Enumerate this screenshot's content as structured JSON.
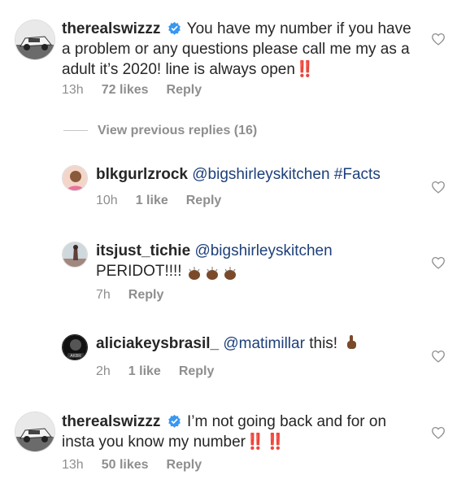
{
  "thread": {
    "view_previous": "View previous replies (16)",
    "comments": [
      {
        "username": "therealswizzz",
        "verified": true,
        "text": "You have my number if you have a problem or any questions please call me my as a adult it’s 2020! line is always open",
        "emoji_suffix": "‼️",
        "time": "13h",
        "likes": "72 likes",
        "reply": "Reply"
      },
      {
        "username": "blkgurlzrock",
        "mention": "@bigshirleyskitchen",
        "hashtag": "#Facts",
        "time": "10h",
        "likes": "1 like",
        "reply": "Reply"
      },
      {
        "username": "itsjust_tichie",
        "mention": "@bigshirleyskitchen",
        "text": "PERIDOT!!!!",
        "emoji": "👏🏾👏🏾👏🏾",
        "time": "7h",
        "reply": "Reply"
      },
      {
        "username": "aliciakeysbrasil_",
        "mention": "@matimillar",
        "text": "this!",
        "emoji": "👆🏾",
        "time": "2h",
        "likes": "1 like",
        "reply": "Reply"
      },
      {
        "username": "therealswizzz",
        "verified": true,
        "text": "I’m not going back and for on insta you know my number",
        "emoji_suffix": "‼️ ‼️",
        "time": "13h",
        "likes": "50 likes",
        "reply": "Reply"
      }
    ]
  },
  "colors": {
    "text": "#262626",
    "muted": "#8e8e8e",
    "link": "#1d3f7a",
    "verified": "#3897f0",
    "bangbang": "#e0261b"
  }
}
